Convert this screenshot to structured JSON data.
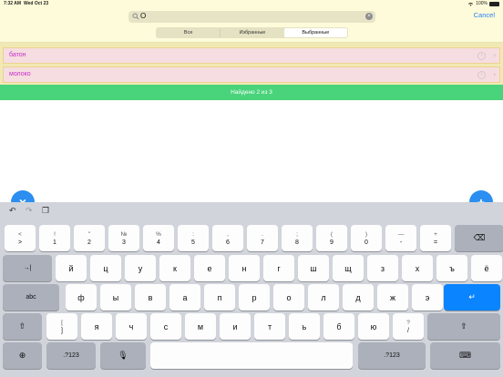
{
  "status": {
    "time": "7:32 AM",
    "date": "Wed Oct 23",
    "battery": "100%"
  },
  "search": {
    "query": "O",
    "cancel": "Cancel"
  },
  "segments": [
    "Все",
    "Избранные",
    "Выбранные"
  ],
  "segments_active": 2,
  "results": [
    {
      "label": "батон"
    },
    {
      "label": "молоко"
    }
  ],
  "found_text": "Найдено 2 из 3",
  "fab": {
    "left": "×",
    "right": "+"
  },
  "keyboard": {
    "numrow": [
      {
        "top": "<",
        "bottom": ">"
      },
      {
        "top": "!",
        "bottom": "1"
      },
      {
        "top": "\"",
        "bottom": "2"
      },
      {
        "top": "№",
        "bottom": "3"
      },
      {
        "top": "%",
        "bottom": "4"
      },
      {
        "top": ":",
        "bottom": "5"
      },
      {
        "top": ",",
        "bottom": "6"
      },
      {
        "top": ".",
        "bottom": "7"
      },
      {
        "top": ";",
        "bottom": "8"
      },
      {
        "top": "(",
        "bottom": "9"
      },
      {
        "top": ")",
        "bottom": "0"
      },
      {
        "top": "—",
        "bottom": "-"
      },
      {
        "top": "+",
        "bottom": "="
      }
    ],
    "row1": [
      "й",
      "ц",
      "у",
      "к",
      "е",
      "н",
      "г",
      "ш",
      "щ",
      "з",
      "х",
      "ъ",
      "ё"
    ],
    "row2": [
      "ф",
      "ы",
      "в",
      "а",
      "п",
      "р",
      "о",
      "л",
      "д",
      "ж",
      "э"
    ],
    "row3": [
      "я",
      "ч",
      "с",
      "м",
      "и",
      "т",
      "ь",
      "б",
      "ю"
    ],
    "row3_left": {
      "top": "[",
      "bottom": "]"
    },
    "row3_right": {
      "top": "?",
      "bottom": "/"
    },
    "tab_key": "→|",
    "caps_key": "abc",
    "numbers_key": ".?123"
  }
}
